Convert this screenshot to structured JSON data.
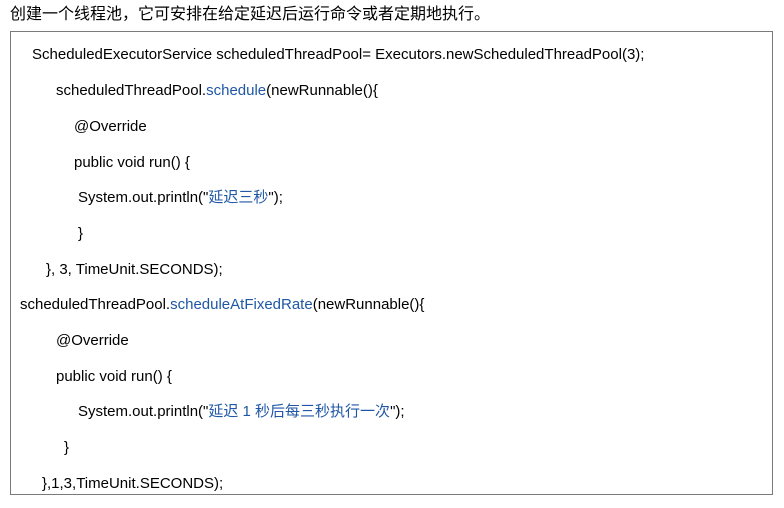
{
  "intro": "创建一个线程池，它可安排在给定延迟后运行命令或者定期地执行。",
  "code": {
    "line1": "ScheduledExecutorService scheduledThreadPool= Executors.newScheduledThreadPool(3);",
    "line2_obj": "scheduledThreadPool.",
    "line2_method": "schedule",
    "line2_rest": "(newRunnable(){",
    "line3": "@Override",
    "line4": "public void run() {",
    "line5_pre": "System.out.println(\"",
    "line5_str": "延迟三秒",
    "line5_post": "\");",
    "line6": "}",
    "line7": "}, 3, TimeUnit.SECONDS);",
    "line8_obj": "scheduledThreadPool.",
    "line8_method": "scheduleAtFixedRate",
    "line8_rest": "(newRunnable(){",
    "line9": "@Override",
    "line10": "public void run() {",
    "line11_pre": "System.out.println(\"",
    "line11_str": "延迟 1 秒后每三秒执行一次",
    "line11_post": "\");",
    "line12": "}",
    "line13": "},1,3,TimeUnit.SECONDS);"
  }
}
